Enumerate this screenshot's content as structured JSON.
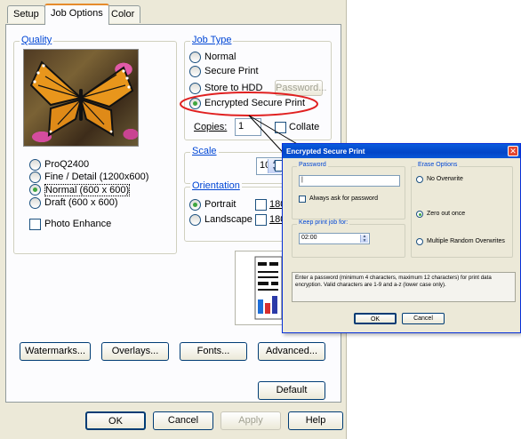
{
  "tabs": [
    "Setup",
    "Job Options",
    "Color"
  ],
  "quality": {
    "legend": "Quality",
    "options": [
      "ProQ2400",
      "Fine / Detail (1200x600)",
      "Normal (600 x 600)",
      "Draft (600 x 600)"
    ],
    "selected_index": 2,
    "photo_enhance_label": "Photo Enhance",
    "photo_enhance_checked": false
  },
  "job_type": {
    "legend": "Job Type",
    "options": [
      "Normal",
      "Secure Print",
      "Store to HDD",
      "Encrypted Secure Print"
    ],
    "selected_index": 3,
    "password_button": "Password...",
    "copies_label": "Copies:",
    "copies_value": "1",
    "collate_label": "Collate",
    "highlight_color": "#e02020"
  },
  "scale": {
    "legend": "Scale",
    "value": "100"
  },
  "orientation": {
    "legend": "Orientation",
    "options": [
      "Portrait",
      "Landscape"
    ],
    "selected_index": 0,
    "rotate_labels": [
      "180",
      "180"
    ]
  },
  "buttons": {
    "watermarks": "Watermarks...",
    "overlays": "Overlays...",
    "fonts": "Fonts...",
    "advanced": "Advanced...",
    "default": "Default"
  },
  "footer": {
    "ok": "OK",
    "cancel": "Cancel",
    "apply": "Apply",
    "help": "Help"
  },
  "popup": {
    "title": "Encrypted Secure Print",
    "password_legend": "Password",
    "password_value": "",
    "always_ask_label": "Always ask for password",
    "keep_legend": "Keep print job for:",
    "keep_value": "02:00",
    "erase_legend": "Erase Options",
    "erase_options": [
      "No Overwrite",
      "Zero out once",
      "Multiple Random Overwrites"
    ],
    "erase_selected_index": 1,
    "info_text": "Enter a password (minimum 4 characters, maximum 12 characters) for print data encryption. Valid characters are 1-9 and a-z (lower case only).",
    "ok": "OK",
    "cancel": "Cancel"
  },
  "colors": {
    "xp_blue": "#0a5bdc",
    "legend_blue": "#0046d5",
    "highlight_red": "#e02020",
    "radio_green": "#3fa63f"
  }
}
